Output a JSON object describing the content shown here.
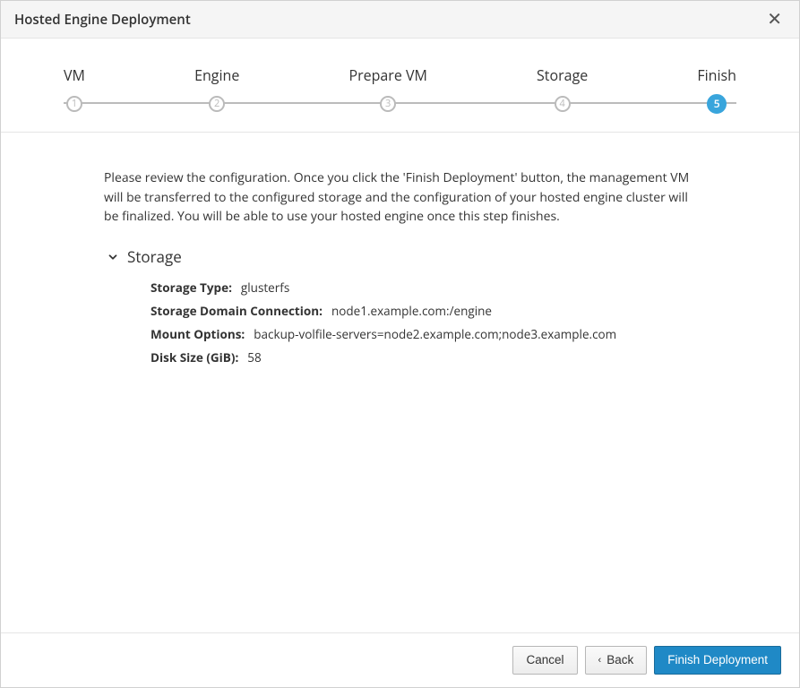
{
  "header": {
    "title": "Hosted Engine Deployment"
  },
  "wizard": {
    "steps": [
      {
        "num": "1",
        "label": "VM"
      },
      {
        "num": "2",
        "label": "Engine"
      },
      {
        "num": "3",
        "label": "Prepare VM"
      },
      {
        "num": "4",
        "label": "Storage"
      },
      {
        "num": "5",
        "label": "Finish"
      }
    ],
    "active_index": 4
  },
  "body": {
    "intro": "Please review the configuration. Once you click the 'Finish Deployment' button, the management VM will be transferred to the configured storage and the configuration of your hosted engine cluster will be finalized. You will be able to use your hosted engine once this step finishes.",
    "section": {
      "title": "Storage",
      "rows": [
        {
          "label": "Storage Type:",
          "value": "glusterfs"
        },
        {
          "label": "Storage Domain Connection:",
          "value": "node1.example.com:/engine"
        },
        {
          "label": "Mount Options:",
          "value": "backup-volfile-servers=node2.example.com;node3.example.com"
        },
        {
          "label": "Disk Size (GiB):",
          "value": "58"
        }
      ]
    }
  },
  "footer": {
    "cancel": "Cancel",
    "back": "Back",
    "finish": "Finish Deployment"
  }
}
